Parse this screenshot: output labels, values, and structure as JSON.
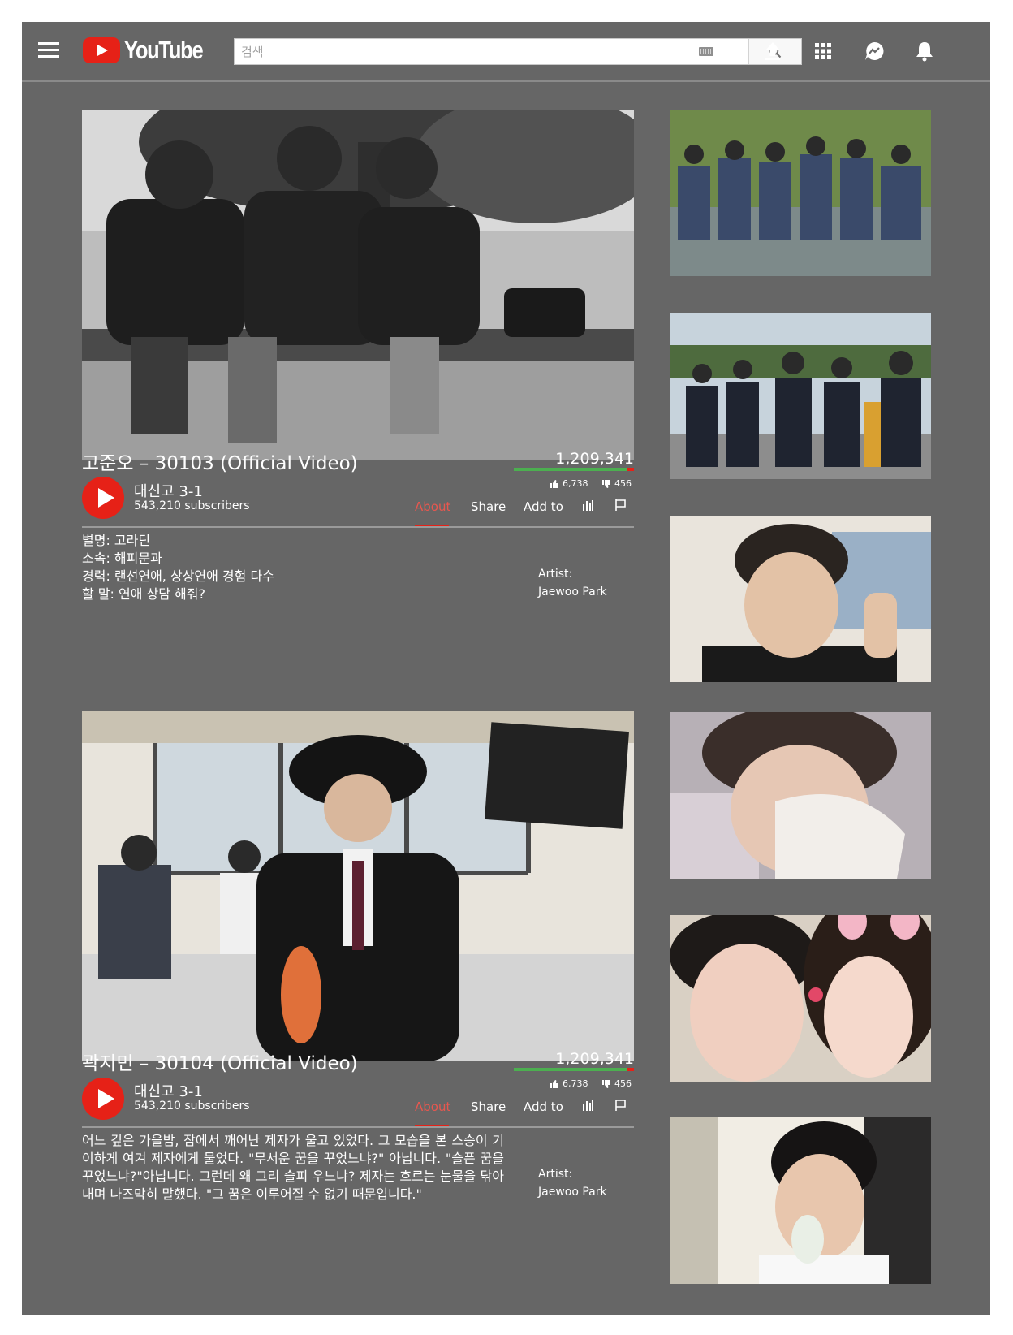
{
  "header": {
    "logo_text": "YouTube",
    "search_placeholder": "검색",
    "icons": [
      "menu-icon",
      "keyboard-icon",
      "search-icon",
      "upload-icon",
      "apps-grid-icon",
      "messages-icon",
      "notifications-bell-icon"
    ]
  },
  "videos": [
    {
      "title": "고준오 – 30103 (Official Video)",
      "views": "1,209,341",
      "likes": "6,738",
      "dislikes": "456",
      "like_ratio": 0.937,
      "channel": "대신고 3-1",
      "subscribers": "543,210 subscribers",
      "tabs": [
        "About",
        "Share",
        "Add to"
      ],
      "active_tab": "About",
      "description_lines": [
        "별명: 고라딘",
        "소속: 해피문과",
        "경력: 랜선연애, 상상연애 경험 다수",
        "할 말: 연애 상담 해줘?"
      ],
      "artist_label": "Artist:",
      "artist_name": "Jaewoo Park",
      "thumbnail": "black-and-white photo of three students sitting on a bench"
    },
    {
      "title": "곽지민 – 30104 (Official Video)",
      "views": "1,209,341",
      "likes": "6,738",
      "dislikes": "456",
      "like_ratio": 0.937,
      "channel": "대신고 3-1",
      "subscribers": "543,210 subscribers",
      "tabs": [
        "About",
        "Share",
        "Add to"
      ],
      "active_tab": "About",
      "description_text": "어느 깊은 가을밤, 잠에서 깨어난 제자가 울고 있었다. 그 모습을 본 스승이 기이하게 여겨 제자에게 물었다. \"무서운 꿈을 꾸었느냐?\" 아닙니다. \"슬픈 꿈을 꾸었느냐?\"아닙니다. 그런데 왜 그리 슬피 우느냐? 제자는 흐르는 눈물을 닦아내며 나즈막히 말했다. \"그 꿈은 이루어질 수 없기 때문입니다.\"",
      "artist_label": "Artist:",
      "artist_name": "Jaewoo Park",
      "thumbnail": "student in black hat and dragon-embroidered jacket in a classroom"
    }
  ],
  "colors": {
    "page_bg": "#666666",
    "accent_red": "#e62117",
    "like_green": "#4caf50",
    "active_tab": "#e8574f"
  }
}
